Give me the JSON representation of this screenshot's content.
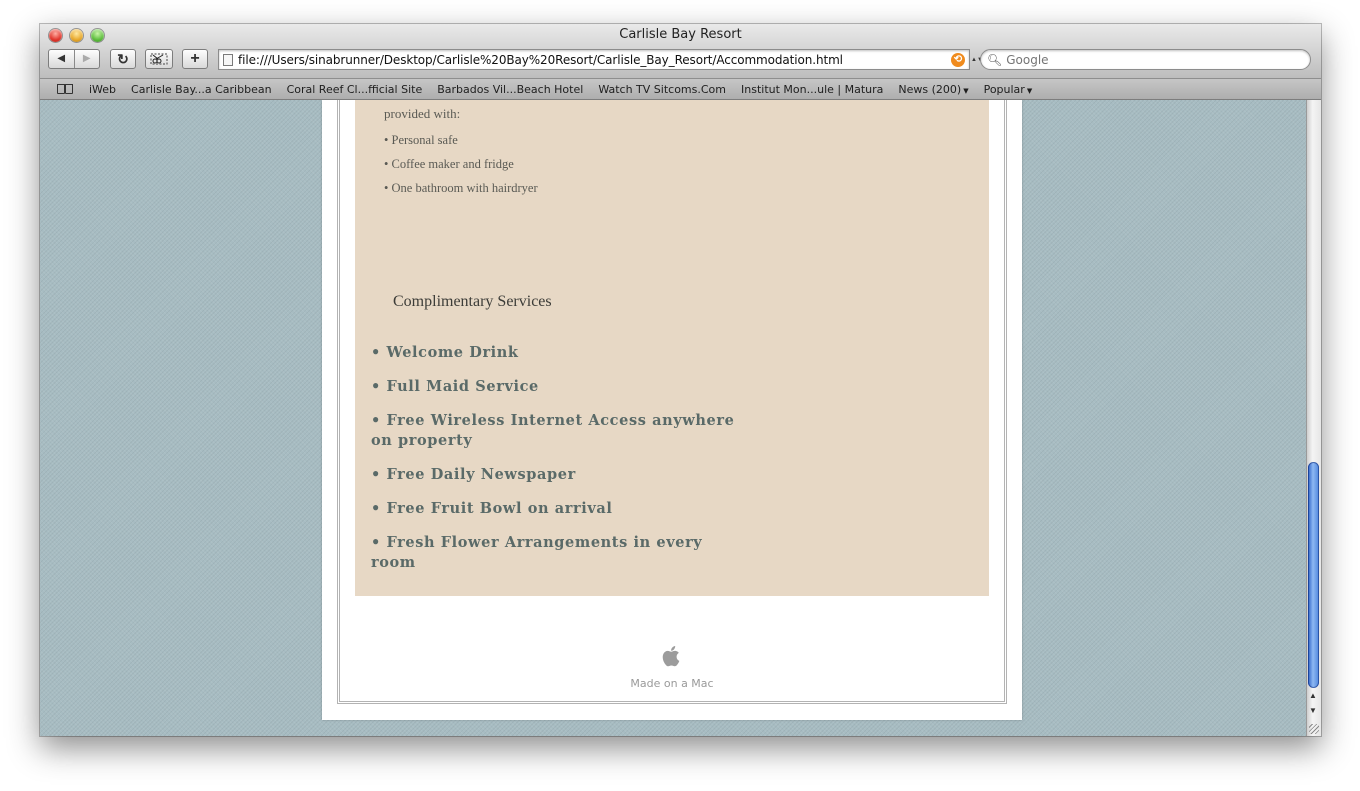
{
  "window": {
    "title": "Carlisle Bay Resort"
  },
  "toolbar": {
    "url": "file:///Users/sinabrunner/Desktop/Carlisle%20Bay%20Resort/Carlisle_Bay_Resort/Accommodation.html",
    "search_placeholder": "Google",
    "back_glyph": "◀",
    "forward_glyph": "▶",
    "reload_glyph": "↻",
    "add_glyph": "+"
  },
  "bookmarks": {
    "items": [
      "iWeb",
      "Carlisle Bay...a Caribbean",
      "Coral Reef Cl...fficial Site",
      "Barbados Vil...Beach Hotel",
      "Watch TV Sitcoms.Com",
      "Institut Mon...ule | Matura",
      "News (200)",
      "Popular"
    ]
  },
  "page": {
    "amenity_intro": "provided with:",
    "amenities": [
      "• Personal safe",
      "• Coffee maker and fridge",
      "• One bathroom with hairdryer"
    ],
    "services_heading": "Complimentary Services",
    "services": [
      "• Welcome Drink",
      "• Full Maid Service",
      "• Free Wireless Internet Access anywhere on property",
      "• Free Daily Newspaper",
      "• Free Fruit Bowl on arrival",
      "• Fresh Flower Arrangements in every room"
    ],
    "footer_text": "Made on a Mac"
  },
  "colors": {
    "background": "#a7bcc2",
    "content_panel": "#e7d8c5",
    "service_text": "#5a6a68",
    "scroll_thumb": "#4f86dc"
  }
}
